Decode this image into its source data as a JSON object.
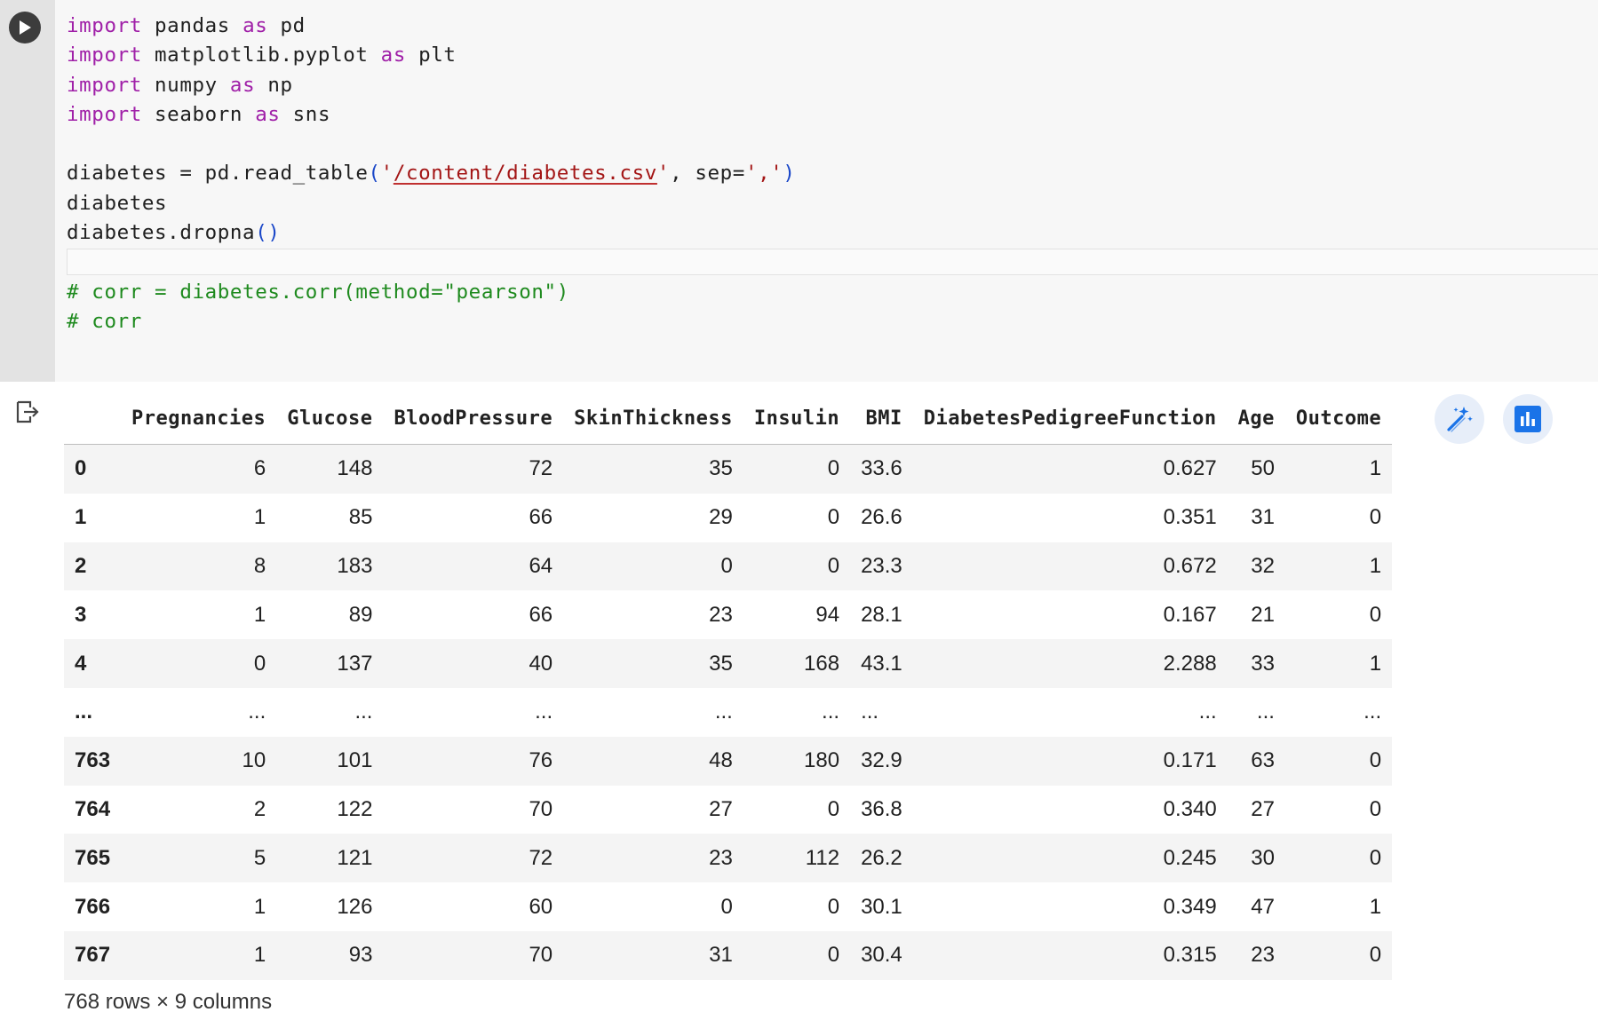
{
  "code": {
    "lines": [
      {
        "kind": "import",
        "kw1": "import",
        "mod": " pandas ",
        "kw2": "as",
        "alias": " pd"
      },
      {
        "kind": "import",
        "kw1": "import",
        "mod": " matplotlib.pyplot ",
        "kw2": "as",
        "alias": " plt"
      },
      {
        "kind": "import",
        "kw1": "import",
        "mod": " numpy ",
        "kw2": "as",
        "alias": " np"
      },
      {
        "kind": "import",
        "kw1": "import",
        "mod": " seaborn ",
        "kw2": "as",
        "alias": " sns"
      }
    ],
    "read_prefix": "diabetes = pd.read_table",
    "read_open": "(",
    "read_q1": "'",
    "read_path": "/content/diabetes.csv",
    "read_q2": "'",
    "read_mid": ", sep=",
    "read_sep": "','",
    "read_close": ")",
    "line_var": "diabetes",
    "dropna_prefix": "diabetes.dropna",
    "dropna_parens": "()",
    "comment1": "# corr = diabetes.corr(method=\"pearson\")",
    "comment2": "# corr"
  },
  "icons": {
    "run": "play-icon",
    "output": "output-redirect-icon",
    "suggest": "magic-wand-icon",
    "chart": "bar-chart-icon"
  },
  "colors": {
    "keyword": "#a020a8",
    "string": "#a31515",
    "comment": "#1e8a1e",
    "paren": "#1a47c8",
    "accent": "#1a73e8"
  },
  "table": {
    "columns": [
      "Pregnancies",
      "Glucose",
      "BloodPressure",
      "SkinThickness",
      "Insulin",
      "BMI",
      "DiabetesPedigreeFunction",
      "Age",
      "Outcome"
    ],
    "rows": [
      {
        "index": "0",
        "cells": [
          "6",
          "148",
          "72",
          "35",
          "0",
          "33.6",
          "0.627",
          "50",
          "1"
        ]
      },
      {
        "index": "1",
        "cells": [
          "1",
          "85",
          "66",
          "29",
          "0",
          "26.6",
          "0.351",
          "31",
          "0"
        ]
      },
      {
        "index": "2",
        "cells": [
          "8",
          "183",
          "64",
          "0",
          "0",
          "23.3",
          "0.672",
          "32",
          "1"
        ]
      },
      {
        "index": "3",
        "cells": [
          "1",
          "89",
          "66",
          "23",
          "94",
          "28.1",
          "0.167",
          "21",
          "0"
        ]
      },
      {
        "index": "4",
        "cells": [
          "0",
          "137",
          "40",
          "35",
          "168",
          "43.1",
          "2.288",
          "33",
          "1"
        ]
      },
      {
        "index": "...",
        "cells": [
          "...",
          "...",
          "...",
          "...",
          "...",
          "...",
          "...",
          "...",
          "..."
        ]
      },
      {
        "index": "763",
        "cells": [
          "10",
          "101",
          "76",
          "48",
          "180",
          "32.9",
          "0.171",
          "63",
          "0"
        ]
      },
      {
        "index": "764",
        "cells": [
          "2",
          "122",
          "70",
          "27",
          "0",
          "36.8",
          "0.340",
          "27",
          "0"
        ]
      },
      {
        "index": "765",
        "cells": [
          "5",
          "121",
          "72",
          "23",
          "112",
          "26.2",
          "0.245",
          "30",
          "0"
        ]
      },
      {
        "index": "766",
        "cells": [
          "1",
          "126",
          "60",
          "0",
          "0",
          "30.1",
          "0.349",
          "47",
          "1"
        ]
      },
      {
        "index": "767",
        "cells": [
          "1",
          "93",
          "70",
          "31",
          "0",
          "30.4",
          "0.315",
          "23",
          "0"
        ]
      }
    ],
    "footer": "768 rows × 9 columns"
  }
}
